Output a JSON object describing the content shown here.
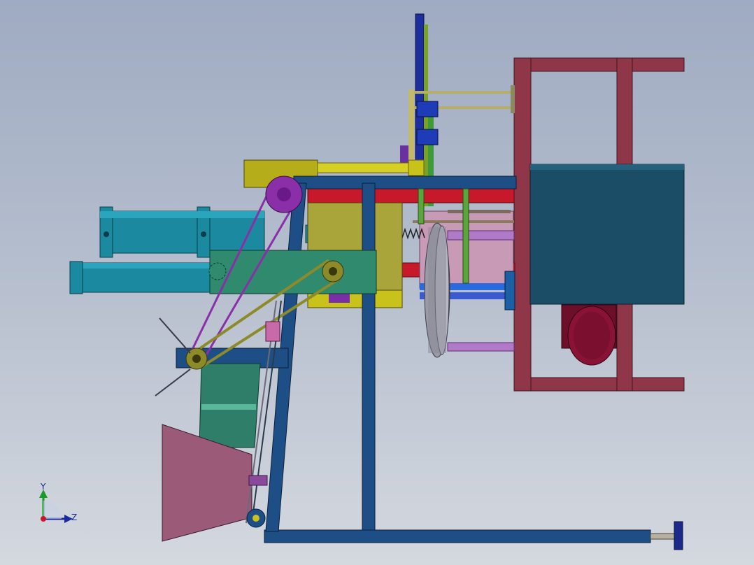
{
  "triad": {
    "y_label": "Y",
    "z_label": "Z"
  },
  "colors": {
    "frame_blue": "#1d4f86",
    "motor_frame": "#8f3649",
    "teal_box": "#1b4e66",
    "cylinder": "#1b8aa0",
    "green_plate": "#2f8a6e",
    "belt_olive": "#8d8a2a",
    "purple": "#8a2fa8",
    "red_rod": "#c8192b",
    "yellow": "#c9c21a"
  }
}
